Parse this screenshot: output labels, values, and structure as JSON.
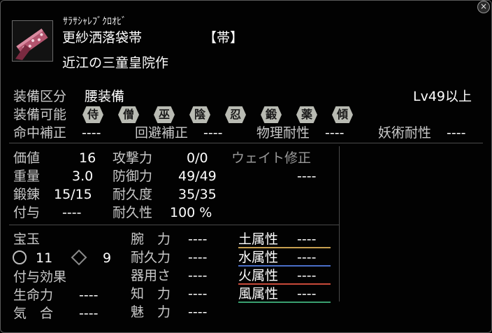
{
  "item": {
    "reading": "ｻﾗｻｼｬﾚﾌﾞｸﾛｵﾋﾞ",
    "name": "更紗洒落袋帯",
    "slot_tag": "【帯】",
    "maker": "近江の三童皇院作",
    "icon": "sash-item-icon"
  },
  "close_icon": "×",
  "equip": {
    "category_label": "装備区分",
    "category_value": "腰装備",
    "level_req": "Lv49以上",
    "usable_label": "装備可能",
    "classes": [
      "侍",
      "僧",
      "巫",
      "陰",
      "忍",
      "鍛",
      "薬",
      "傾"
    ]
  },
  "corrections": [
    {
      "label": "命中補正",
      "value": "----"
    },
    {
      "label": "回避補正",
      "value": "----"
    },
    {
      "label": "物理耐性",
      "value": "----"
    },
    {
      "label": "妖術耐性",
      "value": "----"
    }
  ],
  "stats_left": [
    {
      "label": "価値",
      "value": "16"
    },
    {
      "label": "重量",
      "value": "3.0"
    },
    {
      "label": "鍛錬",
      "value": "15/15"
    },
    {
      "label": "付与",
      "value": "----"
    }
  ],
  "stats_mid": [
    {
      "label": "攻撃力",
      "value": "0/0"
    },
    {
      "label": "防御力",
      "value": "49/49"
    },
    {
      "label": "耐久度",
      "value": "35/35"
    },
    {
      "label": "耐久性",
      "value": "100 %"
    }
  ],
  "weight_fix": {
    "label": "ウェイト修正",
    "value": "----"
  },
  "gems": {
    "label": "宝玉",
    "circle_count": "11",
    "diamond_count": "9",
    "circle_icon": "circle-slot-icon",
    "diamond_icon": "diamond-slot-icon"
  },
  "effect_label": "付与効果",
  "effects": [
    {
      "label": "生命力",
      "value": "----"
    },
    {
      "label": "気　合",
      "value": "----"
    }
  ],
  "attributes": [
    {
      "label": "腕　力",
      "value": "----"
    },
    {
      "label": "耐久力",
      "value": "----"
    },
    {
      "label": "器用さ",
      "value": "----"
    },
    {
      "label": "知　力",
      "value": "----"
    },
    {
      "label": "魅　力",
      "value": "----"
    }
  ],
  "elements": [
    {
      "label": "土属性",
      "value": "----",
      "color": "#c8a050"
    },
    {
      "label": "水属性",
      "value": "----",
      "color": "#4a6ec8"
    },
    {
      "label": "火属性",
      "value": "----",
      "color": "#c84a3a"
    },
    {
      "label": "風属性",
      "value": "----",
      "color": "#3aa070"
    }
  ]
}
